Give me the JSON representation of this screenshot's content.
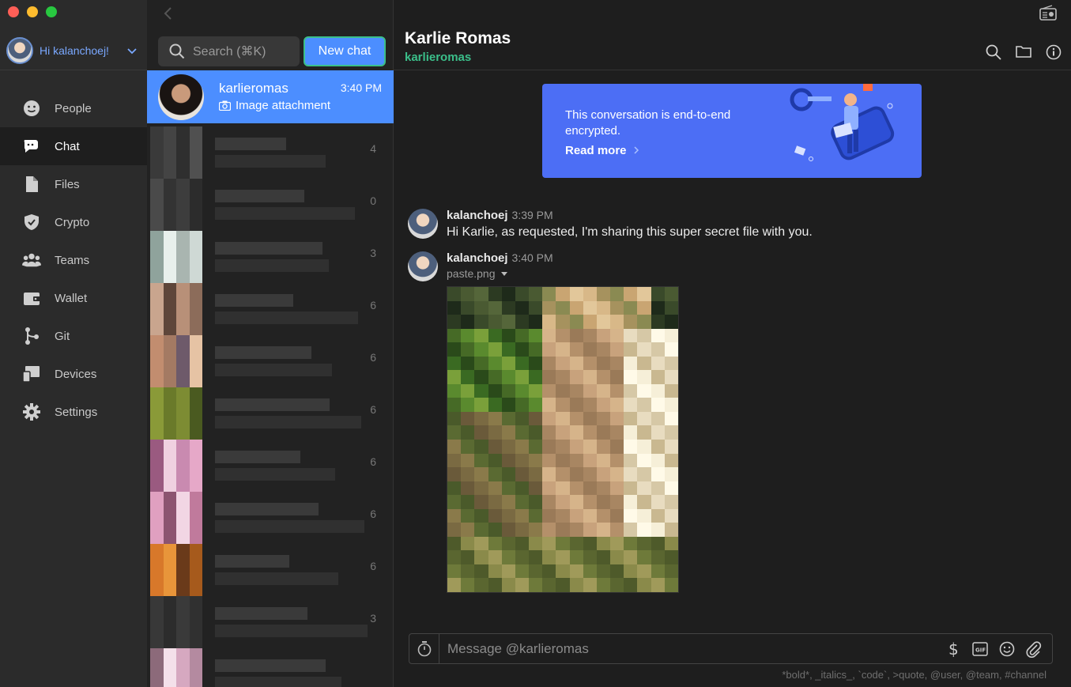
{
  "window": {
    "traffic_lights": [
      "#ff5f57",
      "#febc2e",
      "#28c840"
    ]
  },
  "user": {
    "greeting": "Hi kalanchoej!"
  },
  "nav": {
    "items": [
      {
        "label": "People",
        "icon": "people-icon",
        "active": false
      },
      {
        "label": "Chat",
        "icon": "chat-icon",
        "active": true
      },
      {
        "label": "Files",
        "icon": "files-icon",
        "active": false
      },
      {
        "label": "Crypto",
        "icon": "crypto-shield-icon",
        "active": false
      },
      {
        "label": "Teams",
        "icon": "teams-icon",
        "active": false
      },
      {
        "label": "Wallet",
        "icon": "wallet-icon",
        "active": false
      },
      {
        "label": "Git",
        "icon": "git-icon",
        "active": false
      },
      {
        "label": "Devices",
        "icon": "devices-icon",
        "active": false
      },
      {
        "label": "Settings",
        "icon": "gear-icon",
        "active": false
      }
    ]
  },
  "conversations": {
    "search_placeholder": "Search (⌘K)",
    "new_chat_label": "New chat",
    "active": {
      "name": "karlieromas",
      "time": "3:40 PM",
      "snippet": "Image attachment"
    },
    "blurred_digits": [
      "4",
      "0",
      "3",
      "6",
      "6",
      "6",
      "6",
      "6",
      "6",
      "3"
    ]
  },
  "chat": {
    "title": "Karlie Romas",
    "username": "karlieromas",
    "encryption": {
      "text": "This conversation is end-to-end encrypted.",
      "link": "Read more"
    },
    "messages": [
      {
        "author": "kalanchoej",
        "time": "3:39 PM",
        "text": "Hi Karlie, as requested, I'm sharing this super secret file with you."
      },
      {
        "author": "kalanchoej",
        "time": "3:40 PM",
        "filename": "paste.png"
      }
    ],
    "composer_placeholder": "Message @karlieromas",
    "format_hint": "*bold*, _italics_, `code`, >quote, @user, @team, #channel"
  },
  "colors": {
    "accent": "#4c8eff",
    "green": "#3bbf8a",
    "banner": "#4c6ef5"
  }
}
